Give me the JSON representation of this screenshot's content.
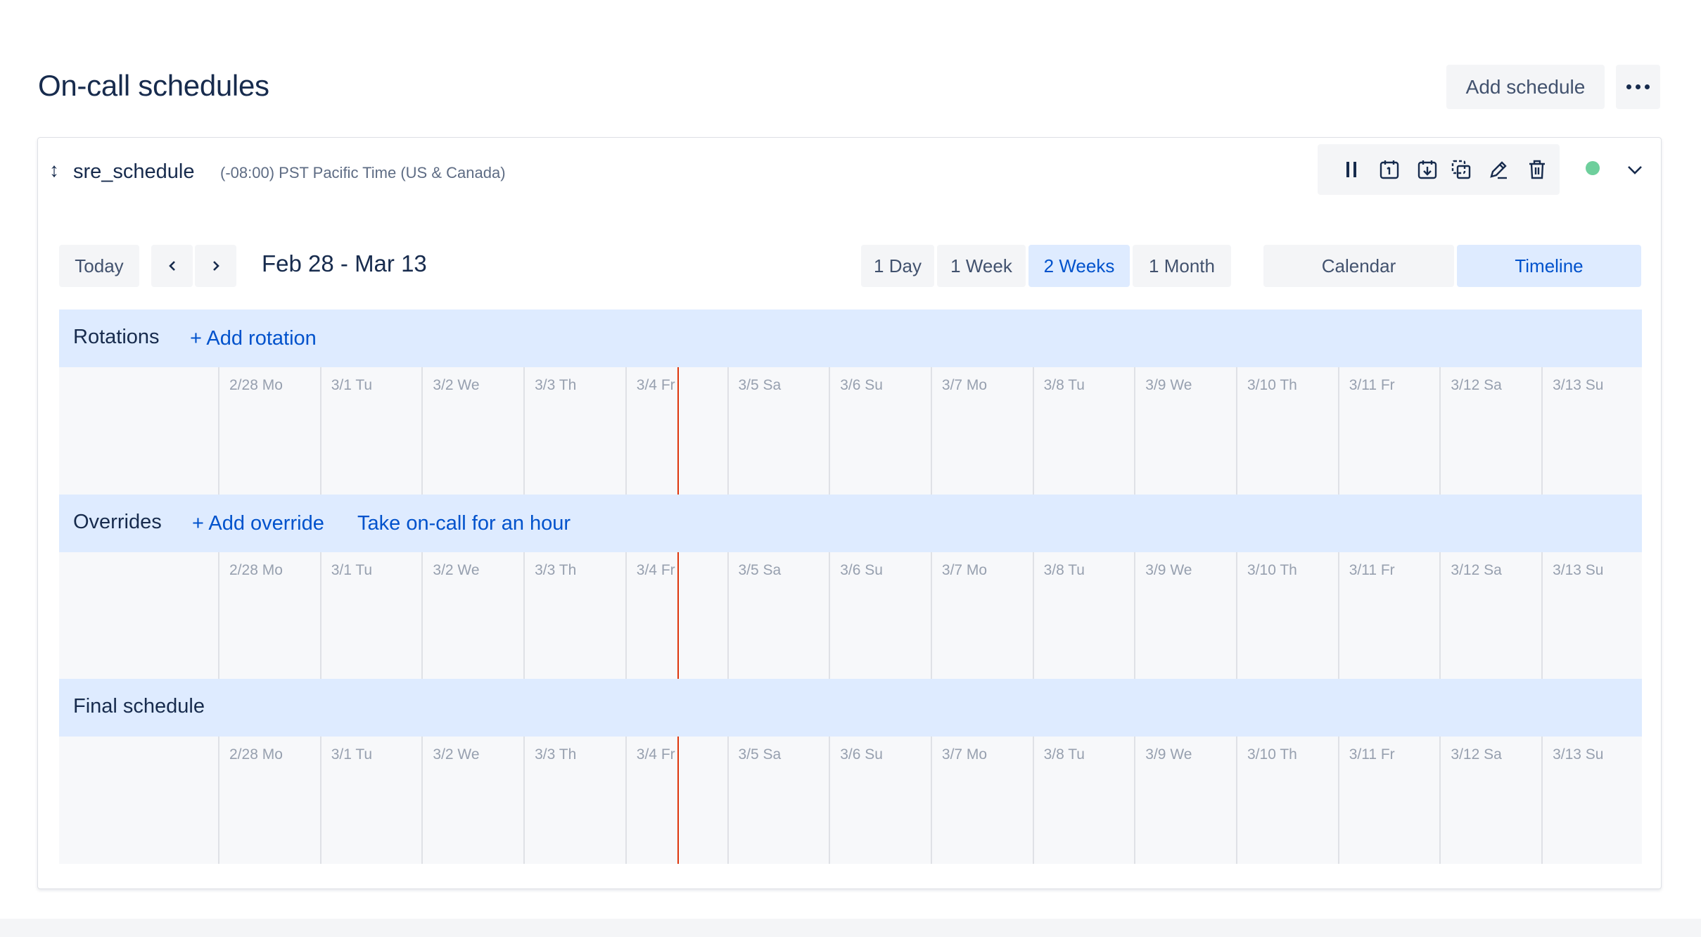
{
  "header": {
    "title": "On-call schedules",
    "add_schedule_label": "Add schedule"
  },
  "schedule": {
    "name": "sre_schedule",
    "timezone": "(-08:00) PST Pacific Time (US & Canada)",
    "status_color": "#6ecf9c"
  },
  "toolbar": {
    "today_label": "Today",
    "range_label": "Feb 28 - Mar 13",
    "ranges": [
      "1 Day",
      "1 Week",
      "2 Weeks",
      "1 Month"
    ],
    "selected_range": "2 Weeks",
    "views": [
      "Calendar",
      "Timeline"
    ],
    "selected_view": "Timeline"
  },
  "sections": {
    "rotations": {
      "title": "Rotations",
      "add_label": "+ Add rotation"
    },
    "overrides": {
      "title": "Overrides",
      "add_label": "+ Add override",
      "take_label": "Take on-call for an hour"
    },
    "final": {
      "title": "Final schedule"
    }
  },
  "days": [
    "2/28 Mo",
    "3/1 Tu",
    "3/2 We",
    "3/3 Th",
    "3/4 Fr",
    "3/5 Sa",
    "3/6 Su",
    "3/7 Mo",
    "3/8 Tu",
    "3/9 We",
    "3/10 Th",
    "3/11 Fr",
    "3/12 Sa",
    "3/13 Su"
  ],
  "colors": {
    "accent": "#0052cc",
    "selected_bg": "#deebff",
    "now_line": "#de350b"
  }
}
